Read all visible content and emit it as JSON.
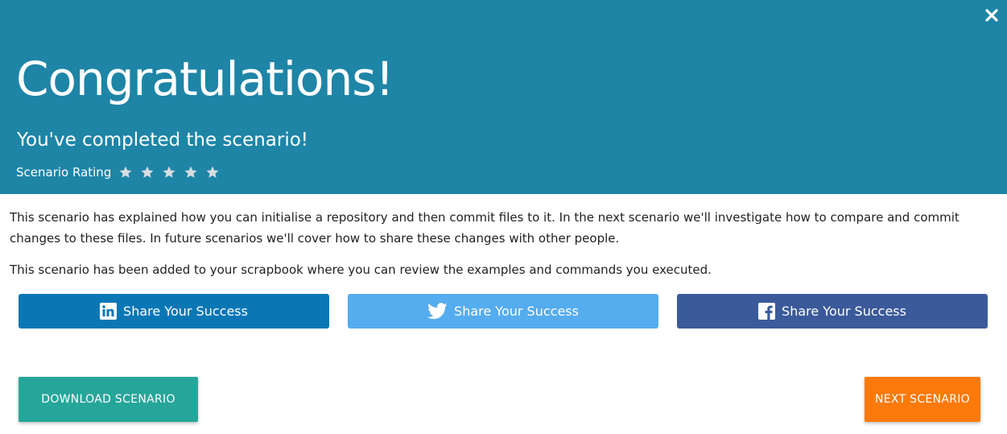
{
  "header": {
    "title": "Congratulations!",
    "subtitle": "You've completed the scenario!",
    "rating_label": "Scenario Rating",
    "rating_star_count": 5,
    "background_color": "#1e85a7",
    "close_icon": "close-icon"
  },
  "content": {
    "paragraph_1": "This scenario has explained how you can initialise a repository and then commit files to it. In the next scenario we'll investigate how to compare and commit changes to these files. In future scenarios we'll cover how to share these changes with other people.",
    "paragraph_2": "This scenario has been added to your scrapbook where you can review the examples and commands you executed."
  },
  "share": {
    "linkedin_label": "Share Your Success",
    "twitter_label": "Share Your Success",
    "facebook_label": "Share Your Success",
    "linkedin_color": "#0a77b5",
    "twitter_color": "#55acee",
    "facebook_color": "#3b5a9a"
  },
  "actions": {
    "download_label": "DOWNLOAD SCENARIO",
    "next_label": "NEXT SCENARIO",
    "download_color": "#26a69a",
    "next_color": "#fb7a0b"
  }
}
